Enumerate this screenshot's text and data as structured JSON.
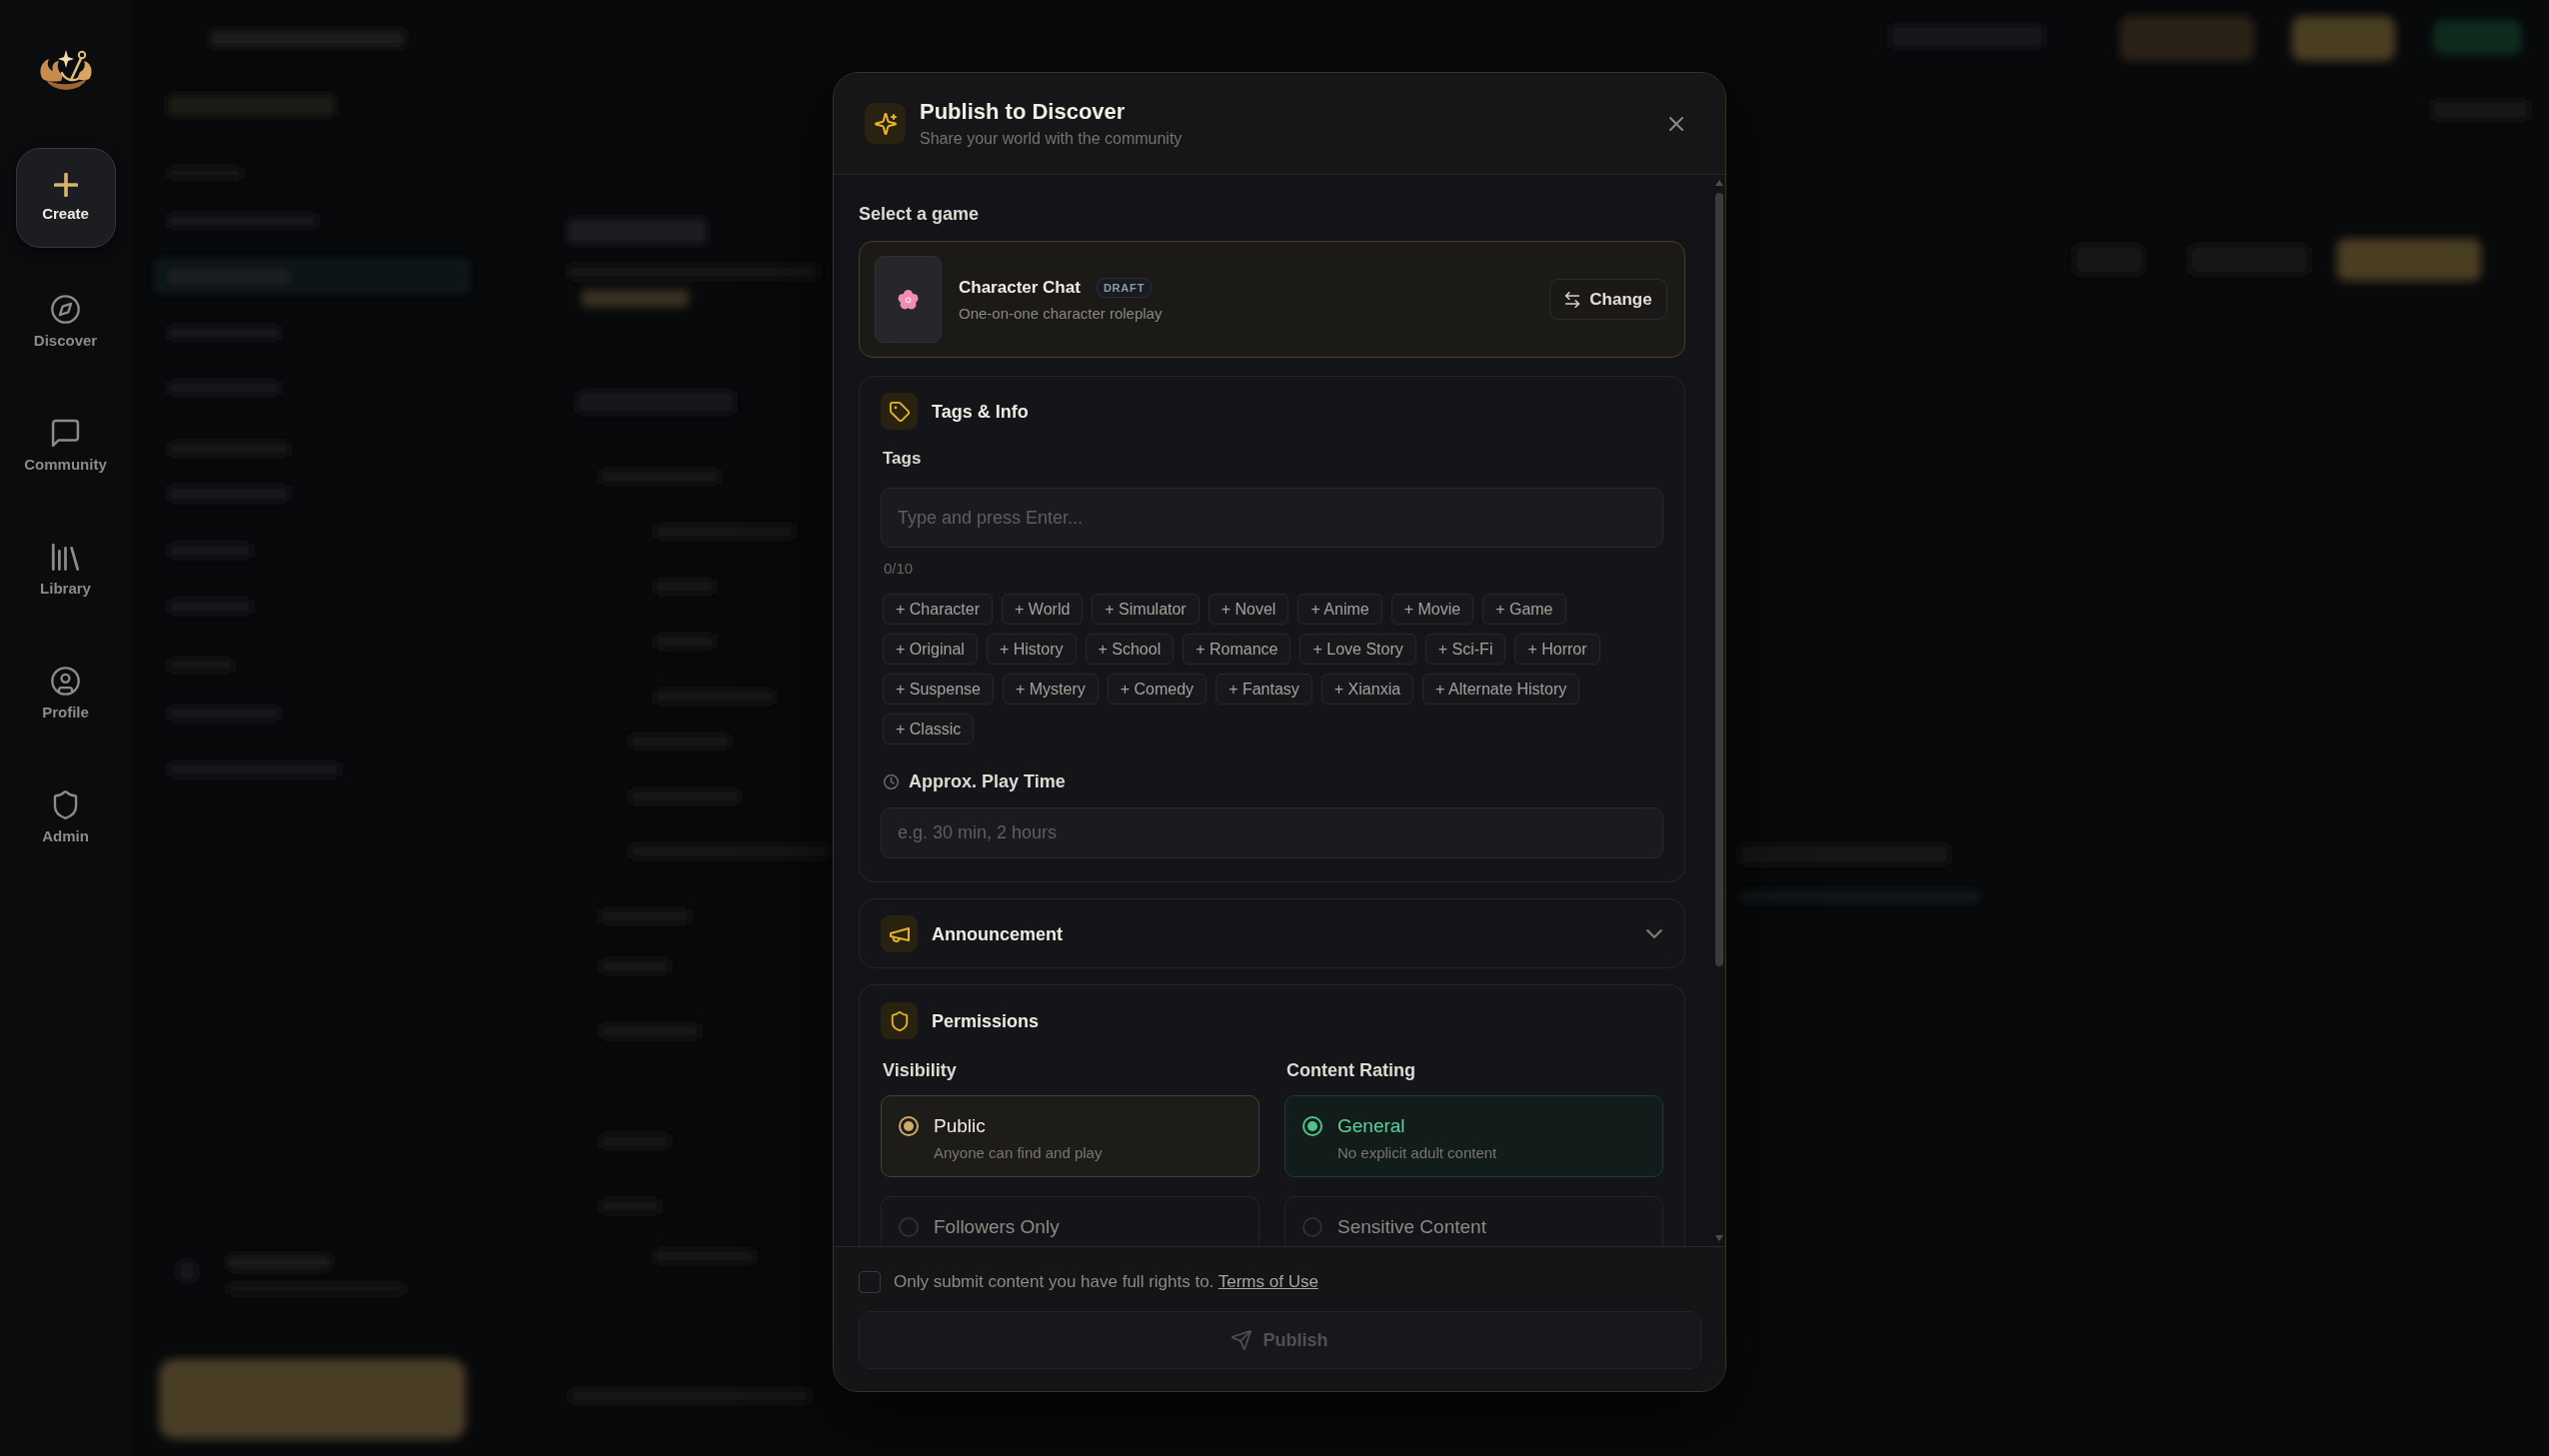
{
  "sidebar": {
    "items": [
      {
        "label": "Create",
        "selected": true
      },
      {
        "label": "Discover",
        "selected": false
      },
      {
        "label": "Community",
        "selected": false
      },
      {
        "label": "Library",
        "selected": false
      },
      {
        "label": "Profile",
        "selected": false
      },
      {
        "label": "Admin",
        "selected": false
      }
    ]
  },
  "dialog": {
    "title": "Publish to Discover",
    "subtitle": "Share your world with the community",
    "game_picker": {
      "label": "Select a game",
      "game": {
        "name": "Character Chat",
        "badge": "DRAFT",
        "description": "One-on-one character roleplay"
      },
      "change_button": "Change"
    },
    "tags_info": {
      "title": "Tags & Info",
      "tags_label": "Tags",
      "tags_input": {
        "placeholder": "Type and press Enter..."
      },
      "tag_count": "0/10",
      "suggested_tags": [
        "+ Character",
        "+ World",
        "+ Simulator",
        "+ Novel",
        "+ Anime",
        "+ Movie",
        "+ Game",
        "+ Original",
        "+ History",
        "+ School",
        "+ Romance",
        "+ Love Story",
        "+ Sci-Fi",
        "+ Horror",
        "+ Suspense",
        "+ Mystery",
        "+ Comedy",
        "+ Fantasy",
        "+ Xianxia",
        "+ Alternate History",
        "+ Classic"
      ],
      "play_time": {
        "label": "Approx. Play Time",
        "placeholder": "e.g. 30 min, 2 hours"
      }
    },
    "announcement": {
      "title": "Announcement",
      "expanded": false
    },
    "permissions": {
      "title": "Permissions",
      "groups": [
        {
          "label": "Visibility",
          "options": [
            {
              "title": "Public",
              "description": "Anyone can find and play",
              "selected": true
            },
            {
              "title": "Followers Only",
              "selected": false
            }
          ]
        },
        {
          "label": "Content Rating",
          "options": [
            {
              "title": "General",
              "description": "No explicit adult content",
              "selected": true
            },
            {
              "title": "Sensitive Content",
              "selected": false
            }
          ]
        }
      ]
    },
    "agreement": {
      "checked": false,
      "text": "Only submit content you have full rights to.",
      "link": "Terms of Use"
    },
    "publish_button": {
      "label": "Publish",
      "disabled": true
    }
  }
}
